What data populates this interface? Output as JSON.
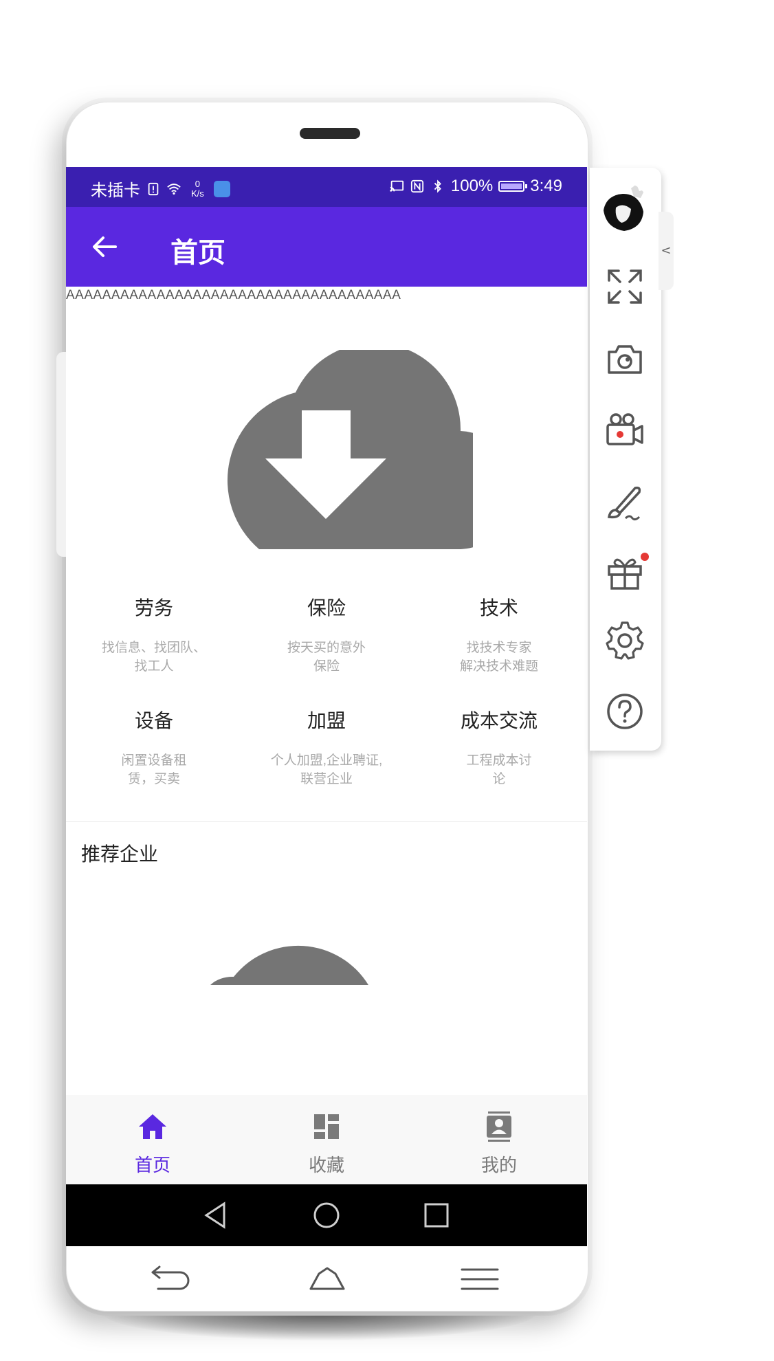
{
  "status_bar": {
    "carrier": "未插卡",
    "speed_value": "0",
    "speed_unit": "K/s",
    "battery": "100%",
    "time": "3:49"
  },
  "app_bar": {
    "title": "首页"
  },
  "marquee": {
    "text": "AAAAAAAAAAAAAAAAAAAAAAAAAAAAAAAAAAAAA"
  },
  "categories": [
    {
      "title": "劳务",
      "desc": "找信息、找团队、\n找工人"
    },
    {
      "title": "保险",
      "desc": "按天买的意外\n保险"
    },
    {
      "title": "技术",
      "desc": "找技术专家\n解决技术难题"
    },
    {
      "title": "设备",
      "desc": "闲置设备租\n赁，买卖"
    },
    {
      "title": "加盟",
      "desc": "个人加盟,企业聘证,\n联营企业"
    },
    {
      "title": "成本交流",
      "desc": "工程成本讨\n论"
    }
  ],
  "recommended": {
    "title": "推荐企业"
  },
  "bottom_nav": [
    {
      "label": "首页",
      "icon": "home-icon",
      "active": true
    },
    {
      "label": "收藏",
      "icon": "dashboard-icon",
      "active": false
    },
    {
      "label": "我的",
      "icon": "contact-icon",
      "active": false
    }
  ],
  "colors": {
    "primary": "#5a28e0",
    "status_bar": "#3a1fb0",
    "placeholder_gray": "#757575",
    "desc_gray": "#a9a9a9",
    "nav_inactive": "#7a7a7a",
    "nav_active": "#5a28e0"
  },
  "floating_toolbar": {
    "tools": [
      "fullscreen-icon",
      "camera-icon",
      "video-record-icon",
      "brush-icon",
      "gift-icon",
      "settings-icon",
      "help-icon"
    ],
    "collapse_glyph": "<"
  }
}
